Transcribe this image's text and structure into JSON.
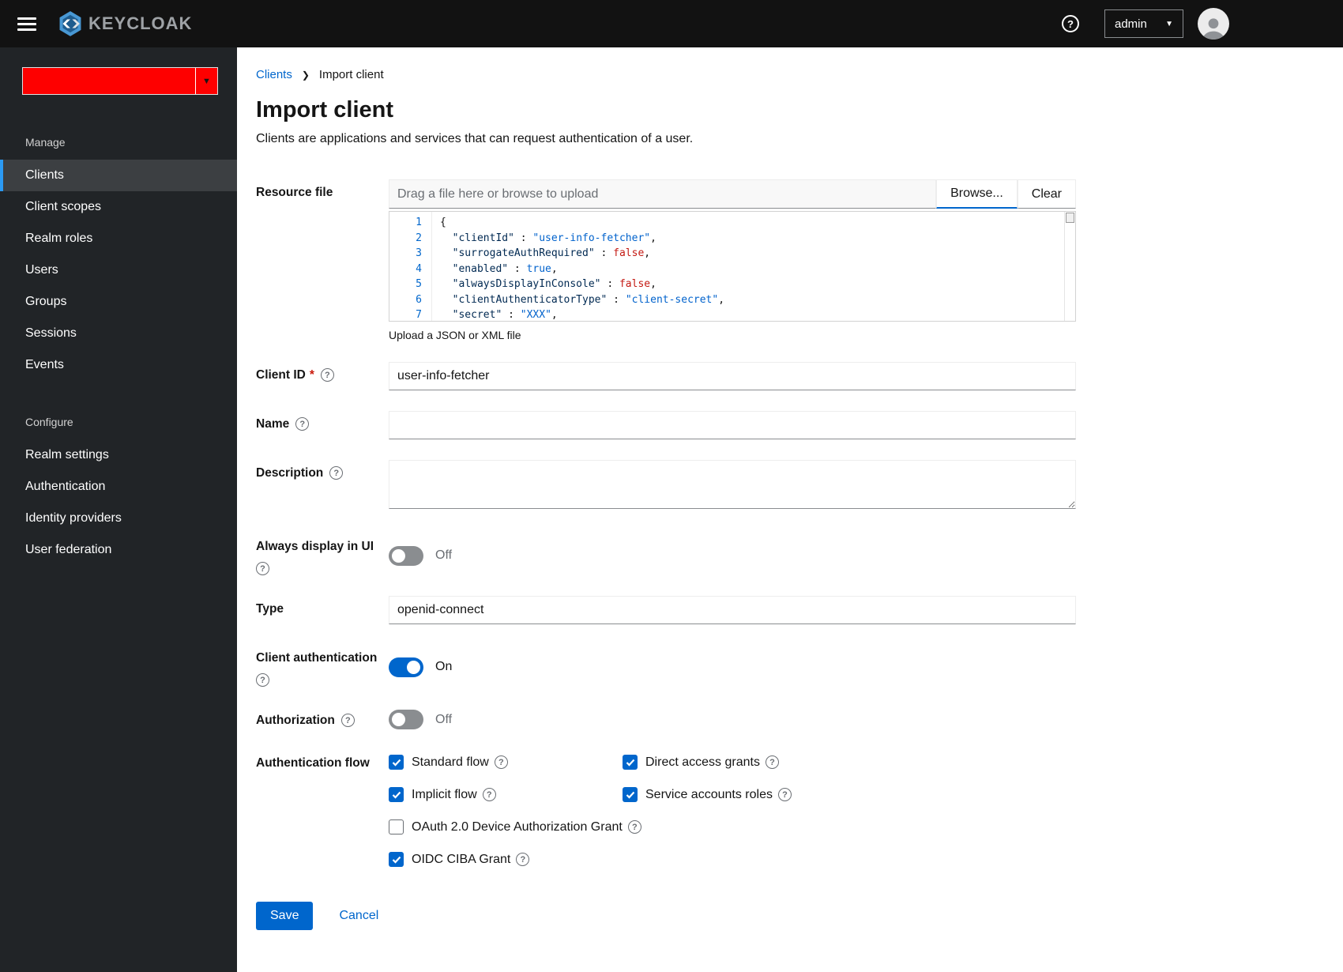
{
  "colors": {
    "accent": "#0066cc",
    "realm_block": "#fe0000",
    "nav_selected_border": "#2b9af3"
  },
  "icons": {
    "question": "?",
    "caret_down": "▼",
    "breadcrumb_separator": "❯"
  },
  "header": {
    "brand": "KEYCLOAK",
    "user": "admin"
  },
  "sidebar": {
    "manage_label": "Manage",
    "manage_items": [
      {
        "label": "Clients",
        "selected": true
      },
      {
        "label": "Client scopes"
      },
      {
        "label": "Realm roles"
      },
      {
        "label": "Users"
      },
      {
        "label": "Groups"
      },
      {
        "label": "Sessions"
      },
      {
        "label": "Events"
      }
    ],
    "configure_label": "Configure",
    "configure_items": [
      {
        "label": "Realm settings"
      },
      {
        "label": "Authentication"
      },
      {
        "label": "Identity providers"
      },
      {
        "label": "User federation"
      }
    ]
  },
  "breadcrumb": {
    "parent": "Clients",
    "current": "Import client"
  },
  "page": {
    "title": "Import client",
    "subtitle": "Clients are applications and services that can request authentication of a user."
  },
  "upload": {
    "label": "Resource file",
    "placeholder": "Drag a file here or browse to upload",
    "browse": "Browse...",
    "clear": "Clear",
    "helper": "Upload a JSON or XML file"
  },
  "code": {
    "lines": [
      {
        "num": "1",
        "tokens": [
          {
            "t": "{",
            "c": "plain"
          }
        ]
      },
      {
        "num": "2",
        "tokens": [
          {
            "t": "  \"clientId\"",
            "c": "key"
          },
          {
            "t": " : ",
            "c": "plain"
          },
          {
            "t": "\"user-info-fetcher\"",
            "c": "string"
          },
          {
            "t": ",",
            "c": "plain"
          }
        ]
      },
      {
        "num": "3",
        "tokens": [
          {
            "t": "  \"surrogateAuthRequired\"",
            "c": "key"
          },
          {
            "t": " : ",
            "c": "plain"
          },
          {
            "t": "false",
            "c": "false"
          },
          {
            "t": ",",
            "c": "plain"
          }
        ]
      },
      {
        "num": "4",
        "tokens": [
          {
            "t": "  \"enabled\"",
            "c": "key"
          },
          {
            "t": " : ",
            "c": "plain"
          },
          {
            "t": "true",
            "c": "true"
          },
          {
            "t": ",",
            "c": "plain"
          }
        ]
      },
      {
        "num": "5",
        "tokens": [
          {
            "t": "  \"alwaysDisplayInConsole\"",
            "c": "key"
          },
          {
            "t": " : ",
            "c": "plain"
          },
          {
            "t": "false",
            "c": "false"
          },
          {
            "t": ",",
            "c": "plain"
          }
        ]
      },
      {
        "num": "6",
        "tokens": [
          {
            "t": "  \"clientAuthenticatorType\"",
            "c": "key"
          },
          {
            "t": " : ",
            "c": "plain"
          },
          {
            "t": "\"client-secret\"",
            "c": "string"
          },
          {
            "t": ",",
            "c": "plain"
          }
        ]
      },
      {
        "num": "7",
        "tokens": [
          {
            "t": "  \"secret\"",
            "c": "key"
          },
          {
            "t": " : ",
            "c": "plain"
          },
          {
            "t": "\"XXX\"",
            "c": "string"
          },
          {
            "t": ",",
            "c": "plain"
          }
        ]
      }
    ]
  },
  "fields": {
    "client_id": {
      "label": "Client ID",
      "required_marker": "*",
      "value": "user-info-fetcher"
    },
    "name": {
      "label": "Name",
      "value": ""
    },
    "description": {
      "label": "Description",
      "value": ""
    },
    "always_display": {
      "label": "Always display in UI",
      "state": "Off"
    },
    "type": {
      "label": "Type",
      "value": "openid-connect"
    },
    "client_auth": {
      "label": "Client authentication",
      "state": "On"
    },
    "authorization": {
      "label": "Authorization",
      "state": "Off"
    },
    "auth_flow_label": "Authentication flow"
  },
  "auth_flow_options": [
    {
      "label": "Standard flow",
      "checked": true
    },
    {
      "label": "Direct access grants",
      "checked": true
    },
    {
      "label": "Implicit flow",
      "checked": true
    },
    {
      "label": "Service accounts roles",
      "checked": true
    },
    {
      "label": "OAuth 2.0 Device Authorization Grant",
      "checked": false,
      "full": true
    },
    {
      "label": "OIDC CIBA Grant",
      "checked": true,
      "full": true
    }
  ],
  "actions": {
    "save": "Save",
    "cancel": "Cancel"
  }
}
